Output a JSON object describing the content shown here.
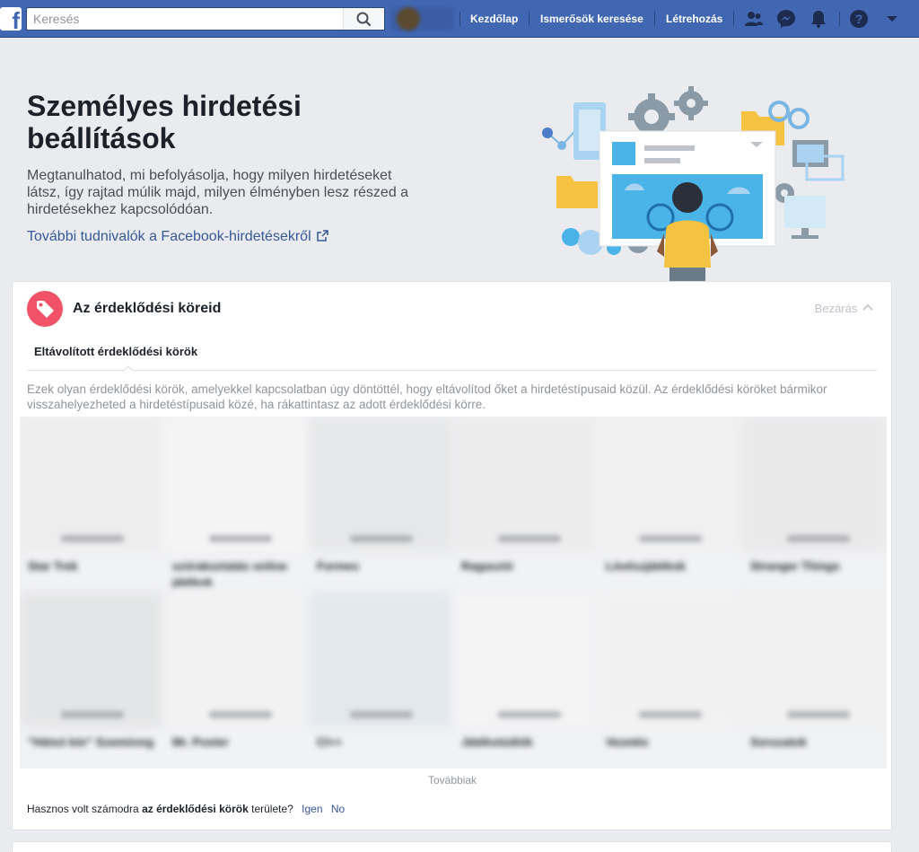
{
  "topbar": {
    "logo": "f",
    "search_placeholder": "Keresés",
    "profile_name": "",
    "nav": [
      "Kezdőlap",
      "Ismerősök keresése",
      "Létrehozás"
    ],
    "icons": [
      "friends-icon",
      "messenger-icon",
      "notifications-icon",
      "help-icon",
      "menu-caret-icon"
    ]
  },
  "hero": {
    "title": "Személyes hirdetési beállítások",
    "description": "Megtanulhatod, mi befolyásolja, hogy milyen hirdetéseket látsz, így rajtad múlik majd, milyen élményben lesz részed a hirdetésekhez kapcsolódóan.",
    "link": "További tudnivalók a Facebook-hirdetésekről",
    "link_icon": "external-link-icon"
  },
  "interests": {
    "title": "Az érdeklődési köreid",
    "close_label": "Bezárás",
    "tab": "Eltávolított érdeklődési körök",
    "description": "Ezek olyan érdeklődési körök, amelyekkel kapcsolatban úgy döntöttél, hogy eltávolítod őket a hirdetéstípusaid közül. Az érdeklődési köröket bármikor visszahelyezheted a hirdetéstípusaid közé, ha rákattintasz az adott érdeklődési körre.",
    "tiles": [
      {
        "name": "Star Trek",
        "name2": "",
        "color": "#ededee"
      },
      {
        "name": "szórakoztatás online",
        "name2": "játékok",
        "color": "#f4f4f5"
      },
      {
        "name": "Formes",
        "name2": "",
        "color": "#e6e7e8"
      },
      {
        "name": "Ragasztó",
        "name2": "",
        "color": "#ececed"
      },
      {
        "name": "Lövészjátékok",
        "name2": "",
        "color": "#f0f0f1"
      },
      {
        "name": "Stranger Things",
        "name2": "",
        "color": "#e9e9ea"
      },
      {
        "name": "\"Hátsó kör\" Szemüveg",
        "name2": "",
        "color": "#e4e5e6"
      },
      {
        "name": "Mr. Poster",
        "name2": "",
        "color": "#f2f2f3"
      },
      {
        "name": "Cl++",
        "name2": "",
        "color": "#e3e8ee"
      },
      {
        "name": "Játékstúdiók",
        "name2": "",
        "color": "#f3f3f4"
      },
      {
        "name": "Vezetés",
        "name2": "",
        "color": "#f1f1f2"
      },
      {
        "name": "Sorozatok",
        "name2": "",
        "color": "#f0f0f0"
      }
    ],
    "more_label": "Továbbiak",
    "feedback_prefix": "Hasznos volt számodra",
    "feedback_bold": "az érdeklődési körök",
    "feedback_suffix": "területe?",
    "yes": "Igen",
    "no": "No"
  },
  "colors": {
    "topbar": "#4267b2",
    "link": "#385898",
    "interest_icon": "#f25268",
    "page_bg": "#e9ebee"
  }
}
